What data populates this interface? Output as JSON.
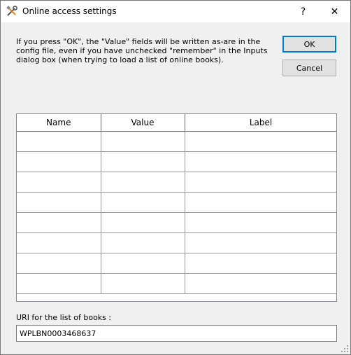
{
  "window": {
    "title": "Online access settings",
    "help_glyph": "?",
    "close_glyph": "✕",
    "icon": "tools-icon"
  },
  "message": "If you press \"OK\", the \"Value\" fields will be written as-are in the config file, even if you have unchecked \"remember\" in the Inputs dialog box (when trying to load a list of online books).",
  "buttons": {
    "ok": "OK",
    "cancel": "Cancel"
  },
  "grid": {
    "columns": [
      "Name",
      "Value",
      "Label"
    ],
    "rows": [
      [
        "",
        "",
        ""
      ],
      [
        "",
        "",
        ""
      ],
      [
        "",
        "",
        ""
      ],
      [
        "",
        "",
        ""
      ],
      [
        "",
        "",
        ""
      ],
      [
        "",
        "",
        ""
      ],
      [
        "",
        "",
        ""
      ],
      [
        "",
        "",
        ""
      ]
    ]
  },
  "uri": {
    "label": "URI for the list of books :",
    "value": "WPLBN0003468637"
  },
  "colors": {
    "accent": "#0078d7",
    "window_bg": "#f0f0f0"
  }
}
